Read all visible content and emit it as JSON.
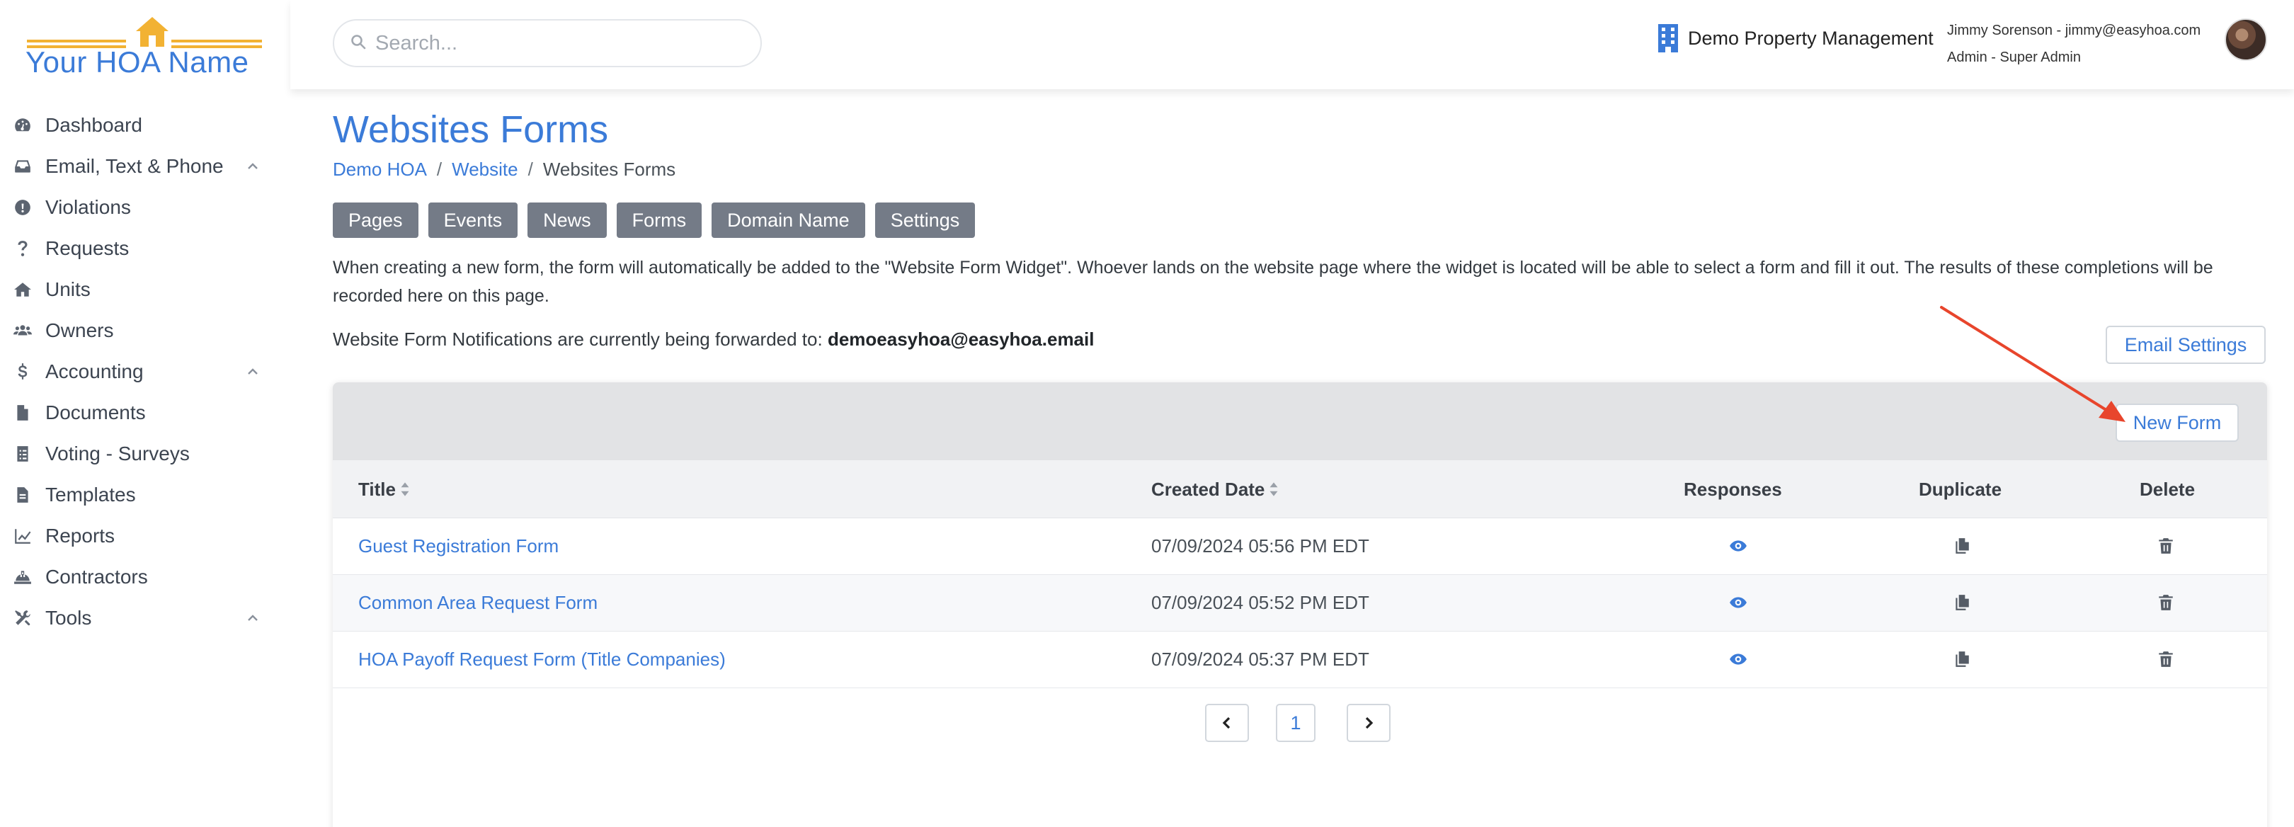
{
  "brand": {
    "logo_text": "Your HOA Name",
    "accent": "#3b7bd8",
    "logo_color": "#f2b233"
  },
  "sidebar": {
    "items": [
      {
        "label": "Dashboard",
        "icon": "dashboard-icon",
        "expandable": false
      },
      {
        "label": "Email, Text & Phone",
        "icon": "inbox-icon",
        "expandable": true
      },
      {
        "label": "Violations",
        "icon": "alert-circle-icon",
        "expandable": false
      },
      {
        "label": "Requests",
        "icon": "question-icon",
        "expandable": false
      },
      {
        "label": "Units",
        "icon": "home-icon",
        "expandable": false
      },
      {
        "label": "Owners",
        "icon": "users-icon",
        "expandable": false
      },
      {
        "label": "Accounting",
        "icon": "dollar-icon",
        "expandable": true
      },
      {
        "label": "Documents",
        "icon": "document-icon",
        "expandable": false
      },
      {
        "label": "Voting - Surveys",
        "icon": "ballot-icon",
        "expandable": false
      },
      {
        "label": "Templates",
        "icon": "template-icon",
        "expandable": false
      },
      {
        "label": "Reports",
        "icon": "chart-line-icon",
        "expandable": false
      },
      {
        "label": "Contractors",
        "icon": "hard-hat-icon",
        "expandable": false
      },
      {
        "label": "Tools",
        "icon": "tools-icon",
        "expandable": true
      }
    ]
  },
  "header": {
    "search_placeholder": "Search...",
    "company": "Demo Property Management",
    "user_line1": "Jimmy Sorenson - jimmy@easyhoa.com",
    "user_line2": "Admin - Super Admin"
  },
  "main": {
    "title": "Websites Forms",
    "breadcrumb": [
      "Demo HOA",
      "Website",
      "Websites Forms"
    ],
    "tabs": [
      "Pages",
      "Events",
      "News",
      "Forms",
      "Domain Name",
      "Settings"
    ],
    "description": "When creating a new form, the form will automatically be added to the \"Website Form Widget\". Whoever lands on the website page where the widget is located will be able to select a form and fill it out. The results of these completions will be recorded here on this page.",
    "notify_prefix": "Website Form Notifications are currently being forwarded to: ",
    "notify_email": "demoeasyhoa@easyhoa.email",
    "email_settings_label": "Email Settings",
    "new_form_label": "New Form"
  },
  "table": {
    "columns": {
      "title": "Title",
      "created": "Created Date",
      "responses": "Responses",
      "duplicate": "Duplicate",
      "delete": "Delete"
    },
    "rows": [
      {
        "title": "Guest Registration Form",
        "created": "07/09/2024 05:56 PM EDT"
      },
      {
        "title": "Common Area Request Form",
        "created": "07/09/2024 05:52 PM EDT"
      },
      {
        "title": "HOA Payoff Request Form (Title Companies)",
        "created": "07/09/2024 05:37 PM EDT"
      }
    ]
  },
  "pagination": {
    "current_page": "1"
  },
  "annotation": {
    "arrow_color": "#e8452c"
  }
}
